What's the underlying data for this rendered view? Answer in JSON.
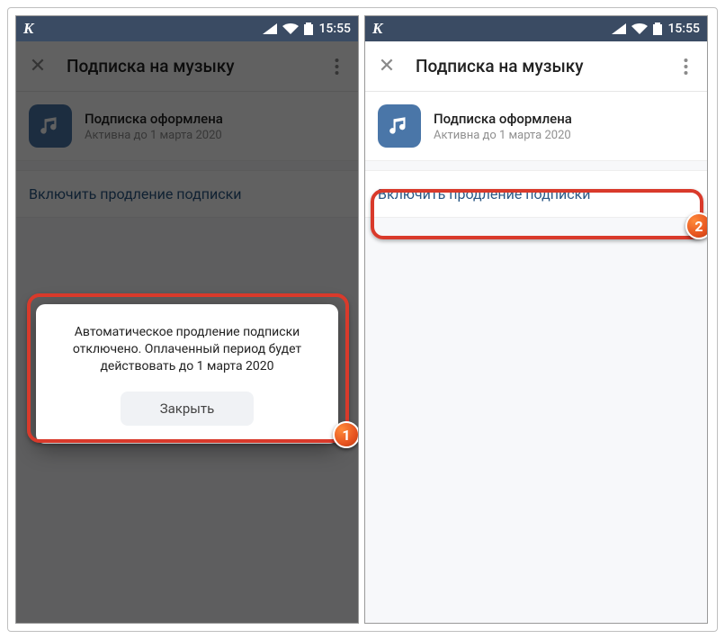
{
  "statusbar": {
    "logo": "K",
    "time": "15:55"
  },
  "appbar": {
    "title": "Подписка на музыку"
  },
  "subscription": {
    "title": "Подписка оформлена",
    "subtitle": "Активна до 1 марта 2020"
  },
  "renew": {
    "label": "Включить продление подписки"
  },
  "dialog": {
    "message": "Автоматическое продление подписки отключено. Оплаченный период будет действовать до 1 марта 2020",
    "close_label": "Закрыть"
  },
  "badges": {
    "one": "1",
    "two": "2"
  }
}
